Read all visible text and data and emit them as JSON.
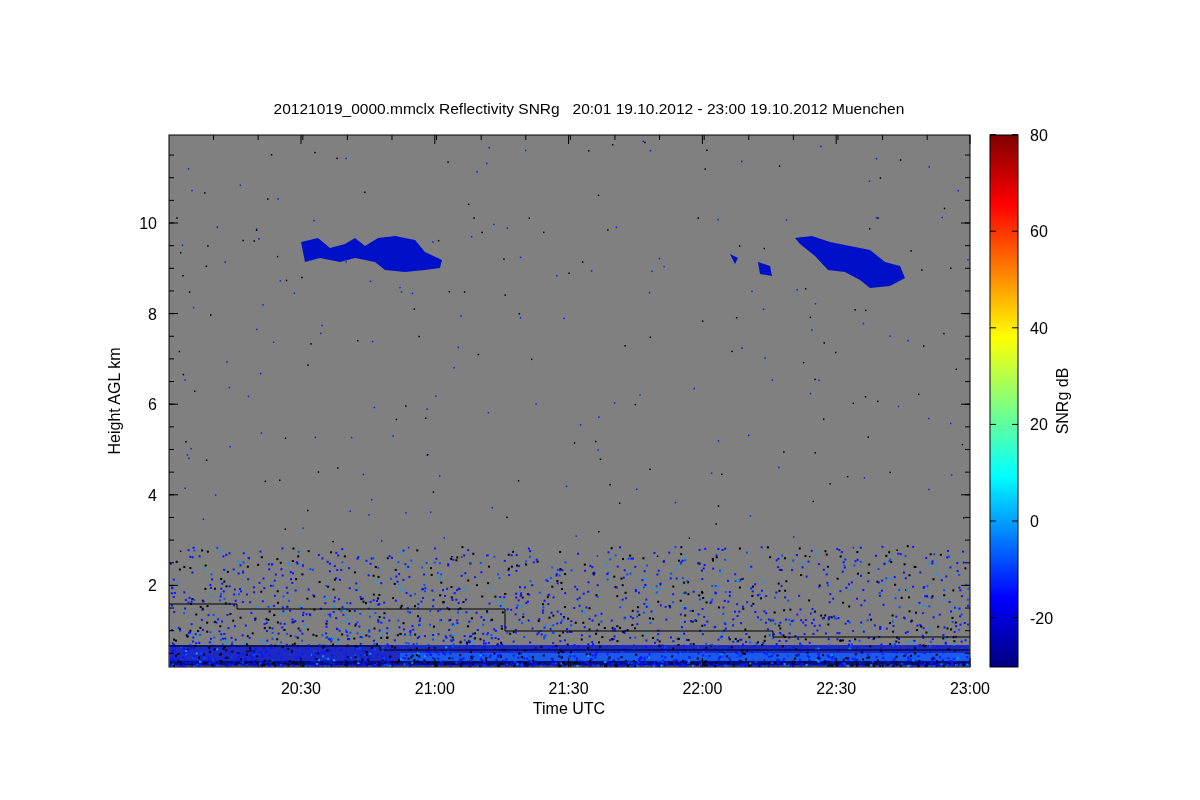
{
  "title": "20121019_0000.mmclx Reflectivity SNRg   20:01 19.10.2012 - 23:00 19.10.2012 Muenchen",
  "plot": {
    "ylabel": "Height AGL km",
    "xlabel": "Time UTC",
    "yticks": [
      "10",
      "8",
      "6",
      "4",
      "2"
    ],
    "xticks": [
      "20:30",
      "21:00",
      "21:30",
      "22:00",
      "22:30",
      "23:00"
    ]
  },
  "colorbar": {
    "label": "SNRg dB",
    "ticks": [
      "80",
      "60",
      "40",
      "20",
      "0",
      "-20"
    ]
  }
}
